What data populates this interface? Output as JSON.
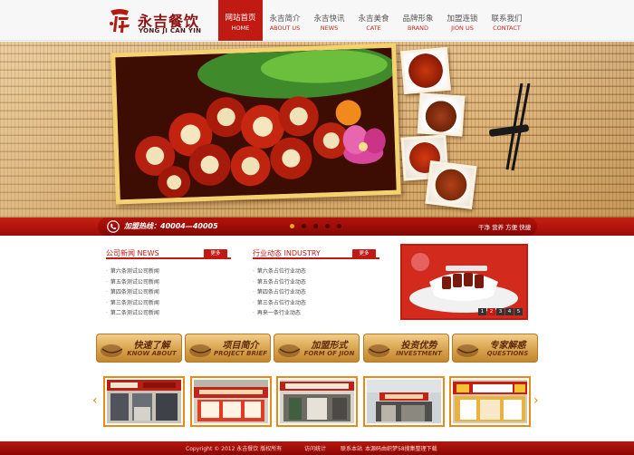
{
  "brand": {
    "name_cn": "永吉餐饮",
    "name_en": "YONG JI CAN YIN",
    "color": "#c01a12"
  },
  "nav": [
    {
      "cn": "网站首页",
      "en": "HOME",
      "active": true
    },
    {
      "cn": "永吉简介",
      "en": "ABOUT US",
      "active": false
    },
    {
      "cn": "永吉快讯",
      "en": "NEWS",
      "active": false
    },
    {
      "cn": "永吉美食",
      "en": "CATE",
      "active": false
    },
    {
      "cn": "品牌形象",
      "en": "BRAND",
      "active": false
    },
    {
      "cn": "加盟连锁",
      "en": "JION US",
      "active": false
    },
    {
      "cn": "联系我们",
      "en": "CONTACT",
      "active": false
    }
  ],
  "hotline": {
    "label": "加盟热线：40004—40005",
    "right_text": "干净 营养 方便 快捷",
    "slide_count": 5,
    "active_slide": 0
  },
  "news": {
    "title": "公司新闻 NEWS",
    "more_label": "更多",
    "items": [
      "第六条测试公司新闻",
      "第五条测试公司新闻",
      "第四条测试公司新闻",
      "第三条测试公司新闻",
      "第二条测试公司新闻"
    ]
  },
  "industry": {
    "title": "行业动态 INDUSTRY",
    "more_label": "更多",
    "items": [
      "第六条占位行业动态",
      "第五条占位行业动态",
      "第四条占位行业动态",
      "第三条占位行业动态",
      "再来一条行业动态"
    ]
  },
  "promo": {
    "pages": [
      "1",
      "2",
      "3",
      "4",
      "5"
    ],
    "active_page": 0
  },
  "features": [
    {
      "cn": "快速了解",
      "en": "KNOW ABOUT"
    },
    {
      "cn": "项目简介",
      "en": "PROJECT BRIEF"
    },
    {
      "cn": "加盟形式",
      "en": "FORM OF JION"
    },
    {
      "cn": "投资优势",
      "en": "INVESTMENT"
    },
    {
      "cn": "专家解惑",
      "en": "QUESTIONS"
    }
  ],
  "gallery": {
    "prev_label": "‹",
    "next_label": "›",
    "count": 5
  },
  "footer": {
    "copyright": "Copyright © 2012 永吉餐饮 版权所有",
    "links": [
      "访问统计",
      "联系本站"
    ],
    "source": "本源码由织梦58搜集整理下载"
  }
}
